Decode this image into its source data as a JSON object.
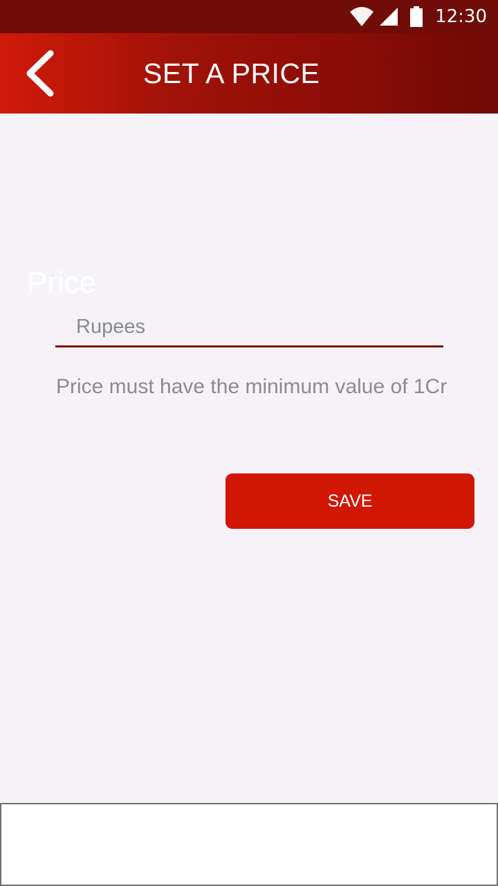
{
  "status_bar": {
    "time": "12:30",
    "icons": [
      "wifi-icon",
      "cellular-signal-icon",
      "battery-icon"
    ]
  },
  "header": {
    "title": "SET A PRICE",
    "back_icon": "chevron-left-icon"
  },
  "form": {
    "price_label": "Price",
    "price_placeholder": "Rupees",
    "price_value": "",
    "helper_text": "Price must have the minimum value of 1Cr",
    "save_label": "SAVE"
  },
  "colors": {
    "status_bar": "#700c05",
    "app_bar_start": "#d11a0a",
    "app_bar_end": "#6f0904",
    "accent": "#d11604",
    "underline": "#7d0c05",
    "background": "#f5f3f8"
  }
}
